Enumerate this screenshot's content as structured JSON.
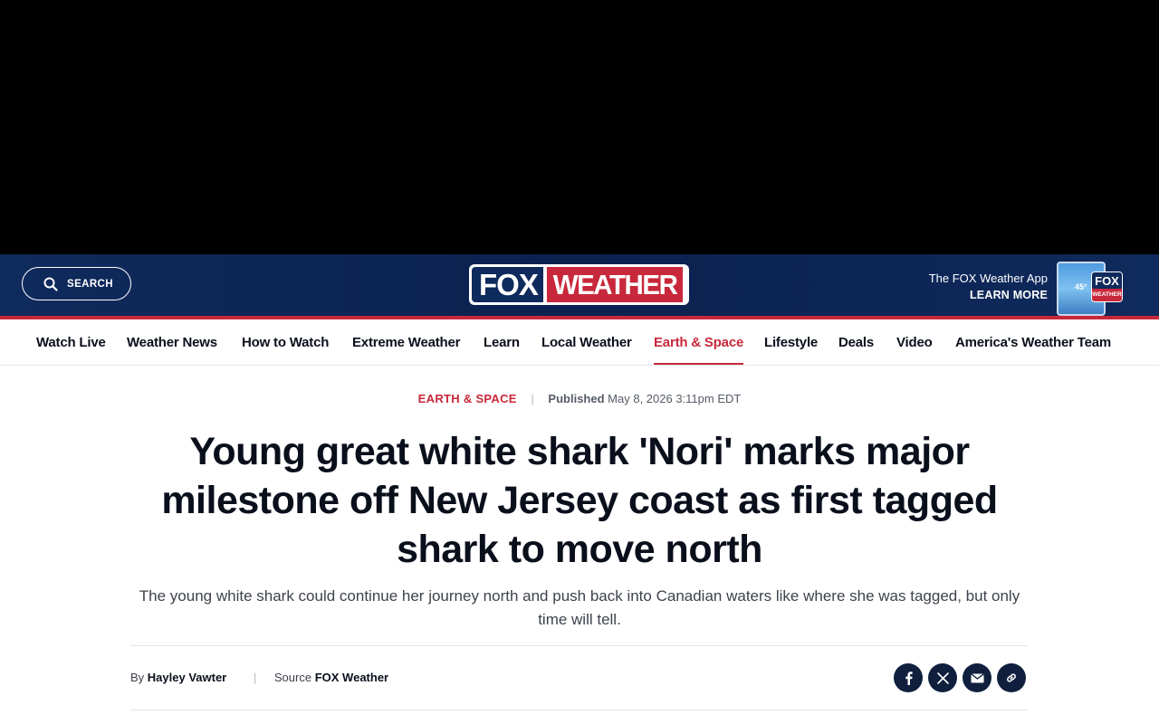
{
  "header": {
    "search_label": "SEARCH",
    "logo_fox": "FOX",
    "logo_weather": "WEATHER",
    "app_promo_line": "The FOX Weather App",
    "app_promo_cta": "LEARN MORE",
    "app_thumb_temp": "45°",
    "app_badge_fox": "FOX",
    "app_badge_weather": "WEATHER"
  },
  "nav": {
    "items": [
      {
        "label": "Watch Live"
      },
      {
        "label": "Weather News"
      },
      {
        "label": "How to Watch"
      },
      {
        "label": "Extreme Weather"
      },
      {
        "label": "Learn"
      },
      {
        "label": "Local Weather"
      },
      {
        "label": "Earth & Space",
        "active": true
      },
      {
        "label": "Lifestyle"
      },
      {
        "label": "Deals"
      },
      {
        "label": "Video"
      },
      {
        "label": "America's Weather Team"
      }
    ]
  },
  "article": {
    "category": "EARTH & SPACE",
    "published_label": "Published",
    "published_date": "May 8, 2026 3:11pm EDT",
    "headline": "Young great white shark 'Nori' marks major milestone off New Jersey coast as first tagged shark to move north",
    "dek": "The young white shark could continue her journey north and push back into Canadian waters like where she was tagged, but only time will tell.",
    "by_label": "By",
    "author": "Hayley Vawter",
    "source_label": "Source",
    "source": "FOX Weather"
  },
  "share": [
    "facebook-icon",
    "x-icon",
    "email-icon",
    "link-icon"
  ],
  "colors": {
    "brand_navy": "#0f2a5c",
    "brand_red": "#c8283b",
    "text_dark": "#0a0f1c"
  }
}
